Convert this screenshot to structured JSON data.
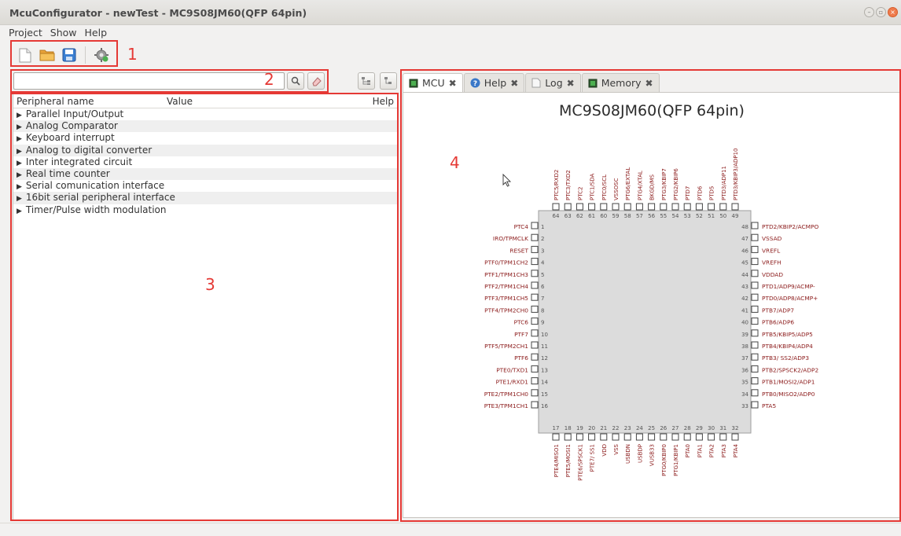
{
  "window": {
    "title": "McuConfigurator - newTest - MC9S08JM60(QFP 64pin)"
  },
  "menu": [
    "Project",
    "Show",
    "Help"
  ],
  "toolbar": {
    "icons": [
      "new-file-icon",
      "open-folder-icon",
      "save-icon",
      "generate-gear-icon"
    ]
  },
  "annotations": {
    "n1": "1",
    "n2": "2",
    "n3": "3",
    "n4": "4"
  },
  "search": {
    "value": ""
  },
  "table": {
    "headers": {
      "name": "Peripheral name",
      "value": "Value",
      "help": "Help"
    },
    "rows": [
      "Parallel Input/Output",
      "Analog Comparator",
      "Keyboard interrupt",
      "Analog to digital converter",
      "Inter integrated circuit",
      "Real time counter",
      "Serial comunication interface",
      "16bit serial peripheral interface",
      "Timer/Pulse width modulation"
    ]
  },
  "tabs": [
    "MCU",
    "Help",
    "Log",
    "Memory"
  ],
  "chip": {
    "title": "MC9S08JM60(QFP 64pin)",
    "left_pins": [
      "PTC4",
      "IRO/TPMCLK",
      "RESET",
      "PTF0/TPM1CH2",
      "PTF1/TPM1CH3",
      "PTF2/TPM1CH4",
      "PTF3/TPM1CH5",
      "PTF4/TPM2CH0",
      "PTC6",
      "PTF7",
      "PTF5/TPM2CH1",
      "PTF6",
      "PTE0/TXD1",
      "PTE1/RXD1",
      "PTE2/TPM1CH0",
      "PTE3/TPM1CH1"
    ],
    "right_pins": [
      "PTD2/KBIP2/ACMPO",
      "VSSAD",
      "VREFL",
      "VREFH",
      "VDDAD",
      "PTD1/ADP9/ACMP-",
      "PTD0/ADP8/ACMP+",
      "PTB7/ADP7",
      "PTB6/ADP6",
      "PTB5/KBIP5/ADP5",
      "PTB4/KBIP4/ADP4",
      "PTB3/ SS2/ADP3",
      "PTB2/SPSCK2/ADP2",
      "PTB1/MOSI2/ADP1",
      "PTB0/MISO2/ADP0",
      "PTA5"
    ],
    "top_pins": [
      "PTC5/RXD2",
      "PTC3/TXD2",
      "PTC2",
      "PTC1/SDA",
      "PTC0/SCL",
      "VSSOSC",
      "PTG6/EXTAL",
      "PTG4/XTAL",
      "BKGD/MS",
      "PTG3/KBIP7",
      "PTG2/KBIP6",
      "PTD7",
      "PTD6",
      "PTD5",
      "PTD3/ADP11",
      "PTD3/KBIP3/ADP10"
    ],
    "top_numbers": [
      "64",
      "63",
      "62",
      "61",
      "60",
      "59",
      "58",
      "57",
      "56",
      "55",
      "54",
      "53",
      "52",
      "51",
      "50",
      "49"
    ],
    "bottom_pins": [
      "PTE4/MISO1",
      "PTE5/MOSI1",
      "PTE6/SPSCK1",
      "PTE7/ SS1",
      "VDD",
      "VSS",
      "USBDN",
      "USBDP",
      "VUSB33",
      "PTG0/KBIP0",
      "PTG1/KBIP1",
      "PTA0",
      "PTA1",
      "PTA2",
      "PTA3",
      "PTA4"
    ],
    "bottom_numbers": [
      "17",
      "18",
      "19",
      "20",
      "21",
      "22",
      "23",
      "24",
      "25",
      "26",
      "27",
      "28",
      "29",
      "30",
      "31",
      "32"
    ],
    "left_numbers": [
      "1",
      "2",
      "3",
      "4",
      "5",
      "6",
      "7",
      "8",
      "9",
      "10",
      "11",
      "12",
      "13",
      "14",
      "15",
      "16"
    ],
    "right_numbers": [
      "48",
      "47",
      "46",
      "45",
      "44",
      "43",
      "42",
      "41",
      "40",
      "39",
      "38",
      "37",
      "36",
      "35",
      "34",
      "33"
    ]
  },
  "colors": {
    "pin_label": "#8b1a1a",
    "annotation": "#e53935",
    "chip_body": "#dcdcdc"
  }
}
